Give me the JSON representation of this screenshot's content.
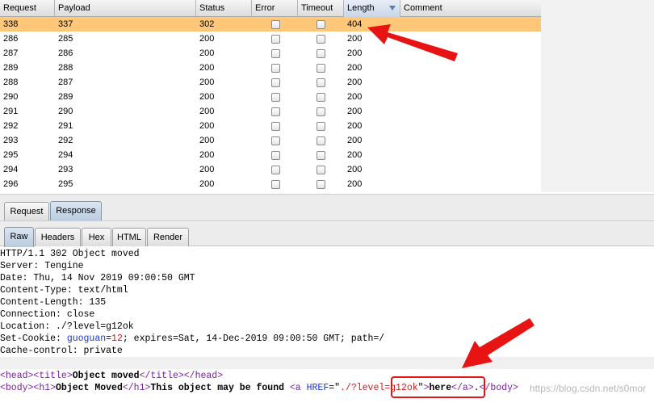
{
  "table": {
    "columns": [
      {
        "key": "request",
        "label": "Request"
      },
      {
        "key": "payload",
        "label": "Payload"
      },
      {
        "key": "status",
        "label": "Status"
      },
      {
        "key": "error",
        "label": "Error"
      },
      {
        "key": "timeout",
        "label": "Timeout"
      },
      {
        "key": "length",
        "label": "Length",
        "sorted": "descending"
      },
      {
        "key": "comment",
        "label": "Comment"
      }
    ],
    "rows": [
      {
        "request": "338",
        "payload": "337",
        "status": "302",
        "length": "404",
        "selected": true
      },
      {
        "request": "286",
        "payload": "285",
        "status": "200",
        "length": "200"
      },
      {
        "request": "287",
        "payload": "286",
        "status": "200",
        "length": "200"
      },
      {
        "request": "289",
        "payload": "288",
        "status": "200",
        "length": "200"
      },
      {
        "request": "288",
        "payload": "287",
        "status": "200",
        "length": "200"
      },
      {
        "request": "290",
        "payload": "289",
        "status": "200",
        "length": "200"
      },
      {
        "request": "291",
        "payload": "290",
        "status": "200",
        "length": "200"
      },
      {
        "request": "292",
        "payload": "291",
        "status": "200",
        "length": "200"
      },
      {
        "request": "293",
        "payload": "292",
        "status": "200",
        "length": "200"
      },
      {
        "request": "295",
        "payload": "294",
        "status": "200",
        "length": "200"
      },
      {
        "request": "294",
        "payload": "293",
        "status": "200",
        "length": "200"
      },
      {
        "request": "296",
        "payload": "295",
        "status": "200",
        "length": "200"
      }
    ]
  },
  "message_tabs": {
    "request": "Request",
    "response": "Response",
    "active": "response"
  },
  "view_tabs": {
    "raw": "Raw",
    "headers": "Headers",
    "hex": "Hex",
    "html": "HTML",
    "render": "Render",
    "active": "raw"
  },
  "response": {
    "status_line": "HTTP/1.1 302 Object moved",
    "server": "Server: Tengine",
    "date": "Date: Thu, 14 Nov 2019 09:00:50 GMT",
    "content_type": "Content-Type: text/html",
    "content_length": "Content-Length: 135",
    "connection": "Connection: close",
    "location": "Location: ./?level=g12ok",
    "set_cookie_prefix": "Set-Cookie: ",
    "cookie_name": "guoguan",
    "cookie_eq": "=",
    "cookie_value": "12",
    "cookie_rest": "; expires=Sat, 14-Dec-2019 09:00:50 GMT; path=/",
    "cache_control": "Cache-control: private",
    "body1": {
      "head_open": "<head>",
      "title_open": "<title>",
      "title_text": "Object moved",
      "title_close": "</title>",
      "head_close": "</head>"
    },
    "body2": {
      "body_open": "<body>",
      "h1_open": "<h1>",
      "h1_text": "Object Moved",
      "h1_close": "</h1>",
      "text": "This object may be found ",
      "a_open": "<a",
      "href_attr": " HREF",
      "href_eq": "=\"",
      "href_value": "./?level=g12ok",
      "href_quote": "\"",
      "a_end": ">",
      "link_text": "here",
      "a_close": "</a>",
      "period": ".",
      "body_close": "</body>"
    }
  },
  "watermark": "https://blog.csdn.net/s0mor",
  "colors": {
    "selected_row": "#ffc777",
    "annotation": "#e81414",
    "tag": "#7a1fa2",
    "attr": "#1c39c8"
  }
}
